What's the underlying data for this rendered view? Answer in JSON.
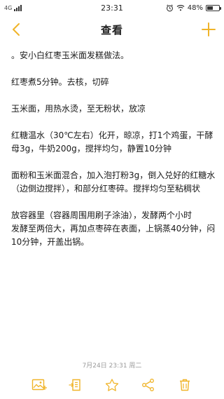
{
  "status_bar": {
    "network": "4G",
    "time": "23:31",
    "battery_percent": "48%",
    "battery_level": 0.48
  },
  "nav": {
    "title": "查看"
  },
  "note": {
    "paragraphs": [
      "。安小白红枣玉米面发糕做法。",
      "红枣煮5分钟。去核，切碎",
      "玉米面，用热水烫，至无粉状，放凉",
      "红糖温水（30℃左右）化开，晾凉，打1个鸡蛋，干酵母3g，牛奶200g，搅拌均匀，静置10分钟",
      "面粉和玉米面混合，加入泡打粉3g，倒入兑好的红糖水（边倒边搅拌），和部分红枣碎。搅拌均匀至粘稠状",
      "放容器里（容器周围用刷子涂油），发酵两个小时",
      "发酵至两倍大，再加点枣碎在表面，上锅蒸40分钟，闷10分钟，开盖出锅。"
    ]
  },
  "footer": {
    "date": "7月24日 23:31 周二"
  },
  "colors": {
    "accent": "#f0b429",
    "text": "#1a1a1a",
    "muted": "#9a9a9a"
  },
  "icons": [
    "back-chevron-icon",
    "add-icon",
    "image-icon",
    "export-icon",
    "star-icon",
    "share-icon",
    "trash-icon"
  ]
}
